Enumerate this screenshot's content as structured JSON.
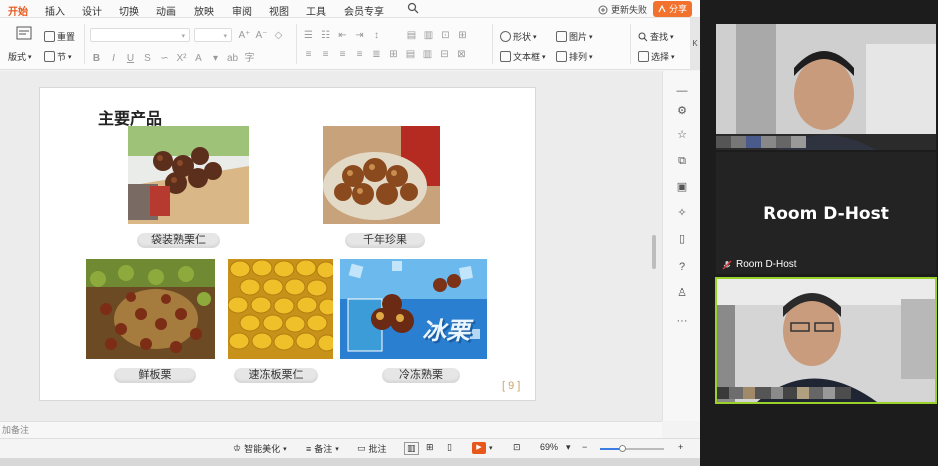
{
  "menu": {
    "tabs": [
      "开始",
      "插入",
      "设计",
      "切换",
      "动画",
      "放映",
      "审阅",
      "视图",
      "工具",
      "会员专享"
    ],
    "active_tab": "开始",
    "update_label": "更新失败",
    "share_label": "分享"
  },
  "ribbon": {
    "reset_label": "重置",
    "layout_label": "版式",
    "section_label": "节",
    "shape_label": "形状",
    "image_label": "图片",
    "find_label": "查找",
    "textbox_label": "文本框",
    "arrange_label": "排列",
    "select_label": "选择"
  },
  "slide": {
    "title": "主要产品",
    "captions": [
      "袋装熟栗仁",
      "千年珍果",
      "鲜板栗",
      "速冻板栗仁",
      "冷冻熟栗"
    ],
    "photo_overlay_text": "冰栗",
    "page_number": "9"
  },
  "notes": {
    "placeholder": "加备注"
  },
  "status": {
    "beautify_label": "智能美化",
    "notes_label": "备注",
    "comment_label": "批注",
    "zoom": "69%",
    "zoom_fraction": 0.35
  },
  "video": {
    "host_tile_name": "Room D-Host",
    "host_label": "Room D-Host"
  },
  "colors": {
    "accent": "#e8581a",
    "share": "#f2712c",
    "active_speaker_border": "#9ad12b"
  }
}
